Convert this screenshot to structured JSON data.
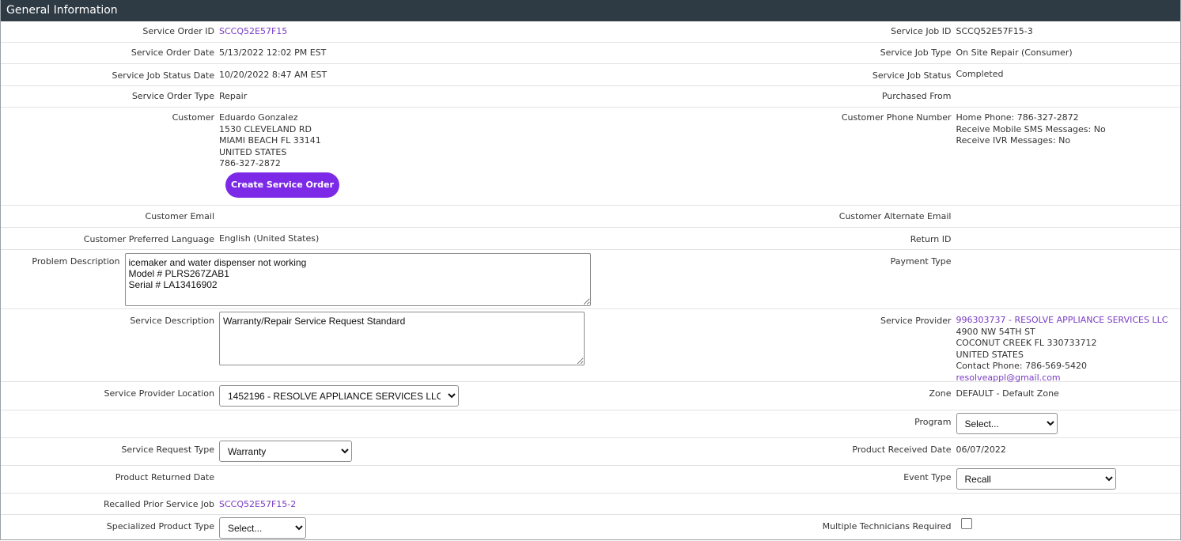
{
  "header": {
    "title": "General Information"
  },
  "rows": {
    "service_order_id": {
      "label": "Service Order ID",
      "value": "SCCQ52E57F15"
    },
    "service_job_id": {
      "label": "Service Job ID",
      "value": "SCCQ52E57F15-3"
    },
    "service_order_date": {
      "label": "Service Order Date",
      "value": "5/13/2022 12:02 PM EST"
    },
    "service_job_type": {
      "label": "Service Job Type",
      "value": "On Site Repair (Consumer)"
    },
    "service_job_status_date": {
      "label": "Service Job Status Date",
      "value": "10/20/2022 8:47 AM EST"
    },
    "service_job_status": {
      "label": "Service Job Status",
      "value": "Completed"
    },
    "service_order_type": {
      "label": "Service Order Type",
      "value": "Repair"
    },
    "purchased_from": {
      "label": "Purchased From",
      "value": ""
    },
    "customer": {
      "label": "Customer",
      "lines": [
        "Eduardo Gonzalez",
        "1530 CLEVELAND RD",
        "MIAMI BEACH FL 33141",
        "UNITED STATES",
        "786-327-2872"
      ],
      "button": "Create Service Order"
    },
    "customer_phone": {
      "label": "Customer Phone Number",
      "lines": [
        "Home Phone: 786-327-2872",
        "Receive Mobile SMS Messages: No",
        "Receive IVR Messages: No"
      ]
    },
    "customer_email": {
      "label": "Customer Email",
      "value": ""
    },
    "customer_alt_email": {
      "label": "Customer Alternate Email",
      "value": ""
    },
    "preferred_language": {
      "label": "Customer Preferred Language",
      "value": "English (United States)"
    },
    "return_id": {
      "label": "Return ID",
      "value": ""
    },
    "problem_description": {
      "label": "Problem Description",
      "value": "icemaker and water dispenser not working\nModel # PLRS267ZAB1\nSerial # LA13416902"
    },
    "payment_type": {
      "label": "Payment Type",
      "value": ""
    },
    "service_description": {
      "label": "Service Description",
      "value": "Warranty/Repair Service Request Standard"
    },
    "service_provider": {
      "label": "Service Provider",
      "link": "996303737 - RESOLVE APPLIANCE SERVICES LLC",
      "lines": [
        "4900 NW 54TH ST",
        "COCONUT CREEK FL 330733712",
        "UNITED STATES",
        "Contact Phone: 786-569-5420"
      ],
      "email": "resolveappl@gmail.com"
    },
    "service_provider_location": {
      "label": "Service Provider Location",
      "selected": "1452196 - RESOLVE APPLIANCE SERVICES LLC"
    },
    "zone": {
      "label": "Zone",
      "value": "DEFAULT - Default Zone"
    },
    "program": {
      "label": "Program",
      "selected": "Select..."
    },
    "service_request_type": {
      "label": "Service Request Type",
      "selected": "Warranty"
    },
    "product_received_date": {
      "label": "Product Received Date",
      "value": "06/07/2022"
    },
    "product_returned_date": {
      "label": "Product Returned Date",
      "value": ""
    },
    "event_type": {
      "label": "Event Type",
      "selected": "Recall"
    },
    "recalled_prior_job": {
      "label": "Recalled Prior Service Job",
      "value": "SCCQ52E57F15-2"
    },
    "specialized_product_type": {
      "label": "Specialized Product Type",
      "selected": "Select..."
    },
    "multiple_technicians": {
      "label": "Multiple Technicians Required",
      "checked": false
    }
  },
  "colors": {
    "header_bg": "#2e3b44",
    "link": "#7a3cc4",
    "button": "#7d2ae8"
  }
}
